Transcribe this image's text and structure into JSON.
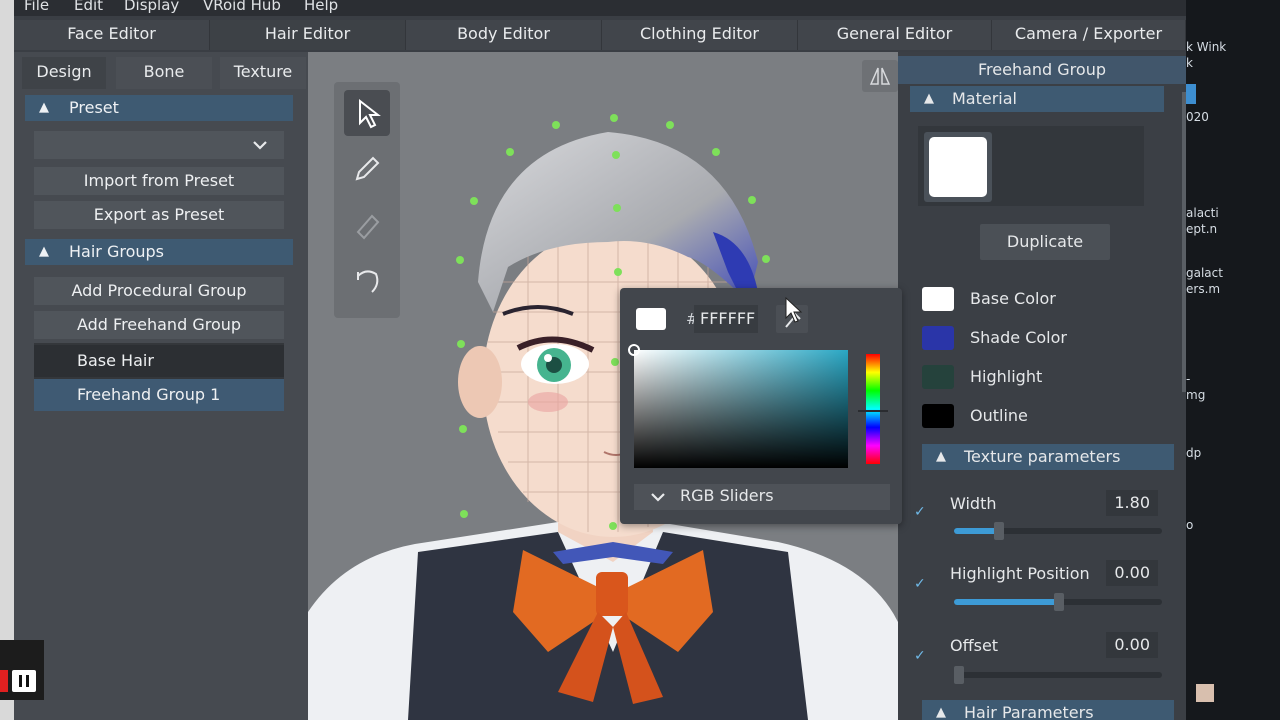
{
  "menu": [
    "File",
    "Edit",
    "Display",
    "VRoid Hub",
    "Help"
  ],
  "editor_tabs": [
    "Face Editor",
    "Hair Editor",
    "Body Editor",
    "Clothing Editor",
    "General Editor",
    "Camera / Exporter"
  ],
  "left_panel": {
    "sub_tabs": [
      "Design",
      "Bone",
      "Texture"
    ],
    "preset": {
      "title": "Preset",
      "import_label": "Import from Preset",
      "export_label": "Export as Preset"
    },
    "hair_groups": {
      "title": "Hair Groups",
      "add_procedural_label": "Add Procedural Group",
      "add_freehand_label": "Add Freehand Group",
      "items": [
        "Base Hair",
        "Freehand Group 1"
      ],
      "selected_index": 1
    }
  },
  "color_picker": {
    "hash": "#",
    "hex_value": "FFFFFF",
    "rgb_sliders_label": "RGB Sliders"
  },
  "right_panel": {
    "header": "Freehand Group",
    "material": {
      "title": "Material",
      "duplicate_label": "Duplicate",
      "colors": [
        {
          "label": "Base Color",
          "color": "#ffffff"
        },
        {
          "label": "Shade Color",
          "color": "#2a35a8"
        },
        {
          "label": "Highlight",
          "color": "#25423c"
        },
        {
          "label": "Outline",
          "color": "#000000"
        }
      ]
    },
    "texture_parameters": {
      "title": "Texture parameters",
      "params": [
        {
          "label": "Width",
          "value": "1.80",
          "fraction": 0.22,
          "checked": true
        },
        {
          "label": "Highlight Position",
          "value": "0.00",
          "fraction": 0.5,
          "checked": true
        },
        {
          "label": "Offset",
          "value": "0.00",
          "fraction": 0.0,
          "checked": true
        }
      ]
    },
    "hair_parameters": {
      "title": "Hair Parameters"
    }
  },
  "background_strip": [
    "k Wink",
    "k",
    "020",
    "alacti",
    "ept.n",
    "galact",
    "ers.m",
    "-",
    "mg",
    "dp",
    "o"
  ]
}
